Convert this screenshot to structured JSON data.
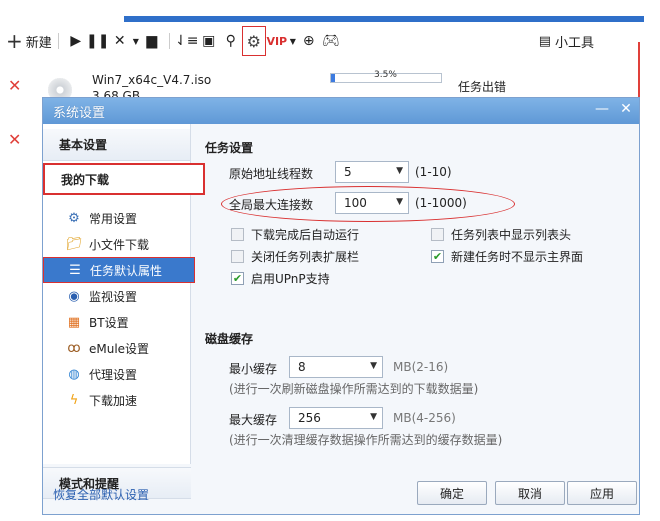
{
  "toolbar": {
    "new_label": "新建",
    "tools_label": "小工具"
  },
  "tasks": [
    {
      "name": "Win7_x64c_V4.7.iso",
      "size": "3.68 GB",
      "progress_percent": 3.5,
      "progress_label": "3.5%",
      "status": "任务出错"
    }
  ],
  "dialog": {
    "title": "系统设置",
    "sidebar": {
      "basic": "基本设置",
      "my_downloads": "我的下载",
      "items": [
        {
          "label": "常用设置",
          "icon": "gear-icon"
        },
        {
          "label": "小文件下载",
          "icon": "folder-download-icon"
        },
        {
          "label": "任务默认属性",
          "icon": "list-icon"
        },
        {
          "label": "监视设置",
          "icon": "monitor-eye-icon"
        },
        {
          "label": "BT设置",
          "icon": "bt-icon"
        },
        {
          "label": "eMule设置",
          "icon": "emule-icon"
        },
        {
          "label": "代理设置",
          "icon": "globe-icon"
        },
        {
          "label": "下载加速",
          "icon": "lightning-icon"
        }
      ],
      "mode": "模式和提醒"
    },
    "task_settings": {
      "title": "任务设置",
      "origin_threads_label": "原始地址线程数",
      "origin_threads_value": "5",
      "origin_threads_range": "(1-10)",
      "max_conn_label": "全局最大连接数",
      "max_conn_value": "100",
      "max_conn_range": "(1-1000)",
      "checkboxes": [
        {
          "label": "下载完成后自动运行",
          "checked": false
        },
        {
          "label": "任务列表中显示列表头",
          "checked": false
        },
        {
          "label": "关闭任务列表扩展栏",
          "checked": false
        },
        {
          "label": "新建任务时不显示主界面",
          "checked": true
        },
        {
          "label": "启用UPnP支持",
          "checked": true
        }
      ]
    },
    "disk_cache": {
      "title": "磁盘缓存",
      "min_label": "最小缓存",
      "min_value": "8",
      "min_unit": "MB(2-16)",
      "min_hint": "(进行一次刷新磁盘操作所需达到的下载数据量)",
      "max_label": "最大缓存",
      "max_value": "256",
      "max_unit": "MB(4-256)",
      "max_hint": "(进行一次清理缓存数据操作所需达到的缓存数据量)"
    },
    "footer": {
      "restore": "恢复全部默认设置",
      "ok": "确定",
      "cancel": "取消",
      "apply": "应用"
    }
  },
  "colors": {
    "accent": "#3a79cc",
    "highlight_red": "#d93030",
    "check_green": "#2a9a2a"
  }
}
